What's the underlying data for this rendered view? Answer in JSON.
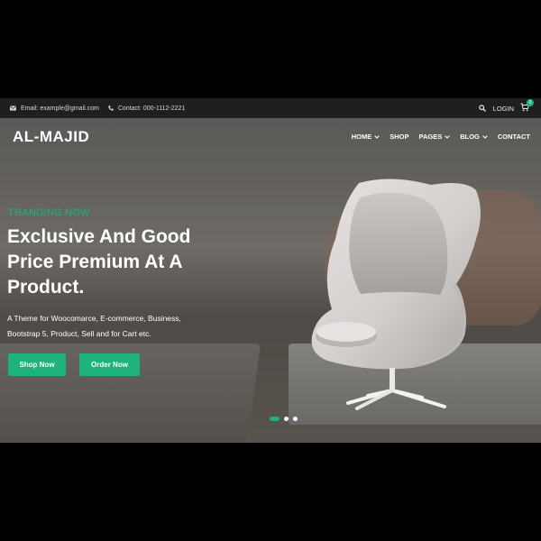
{
  "topbar": {
    "email": "Email: example@gmail.com",
    "contact": "Contact: 000-1112-2221",
    "login": "LOGIN",
    "cart_count": "0"
  },
  "header": {
    "brand": "AL-MAJID",
    "nav": [
      {
        "label": "HOME",
        "dropdown": true
      },
      {
        "label": "SHOP",
        "dropdown": false
      },
      {
        "label": "PAGES",
        "dropdown": true
      },
      {
        "label": "BLOG",
        "dropdown": true
      },
      {
        "label": "CONTACT",
        "dropdown": false
      }
    ]
  },
  "hero": {
    "tag": "TRANDING NOW",
    "headline": [
      "Exclusive And Good",
      "Price Premium At A",
      "Product."
    ],
    "description": [
      "A Theme for Woocomarce, E-commerce, Business,",
      "Bootstrap 5, Product, Sell and for Cart etc."
    ],
    "shop_button": "Shop Now",
    "order_button": "Order Now",
    "slides": 3,
    "active_slide": 1
  },
  "colors": {
    "accent": "#1db37a",
    "topbar_bg": "#1f1f1f"
  }
}
